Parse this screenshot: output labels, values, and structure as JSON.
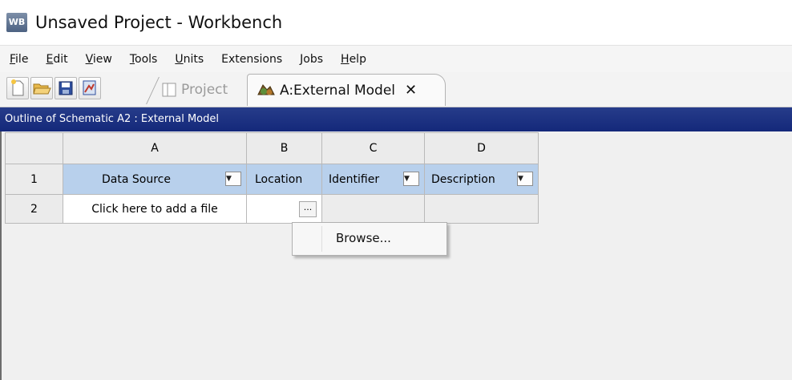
{
  "window": {
    "title": "Unsaved Project - Workbench",
    "logo_text": "WB"
  },
  "menu": [
    {
      "u": "F",
      "rest": "ile"
    },
    {
      "u": "E",
      "rest": "dit"
    },
    {
      "u": "V",
      "rest": "iew"
    },
    {
      "u": "T",
      "rest": "ools"
    },
    {
      "u": "U",
      "rest": "nits"
    },
    {
      "u": "",
      "rest": "Extensions"
    },
    {
      "u": "",
      "rest": "Jobs"
    },
    {
      "u": "H",
      "rest": "elp"
    }
  ],
  "toolbar": {
    "buttons": [
      "new-icon",
      "open-icon",
      "save-icon",
      "save-as-icon"
    ],
    "tab_project": "Project",
    "tab_active": "A:External Model",
    "tab_close": "✕"
  },
  "outline": {
    "title": "Outline of Schematic A2 : External Model"
  },
  "table": {
    "columns": [
      "A",
      "B",
      "C",
      "D"
    ],
    "row_numbers": [
      "1",
      "2"
    ],
    "headers": [
      "Data Source",
      "Location",
      "Identifier",
      "Description"
    ],
    "row2": {
      "data_source": "Click here to add a file",
      "browse_btn": "..."
    }
  },
  "context_menu": {
    "item": "Browse..."
  }
}
